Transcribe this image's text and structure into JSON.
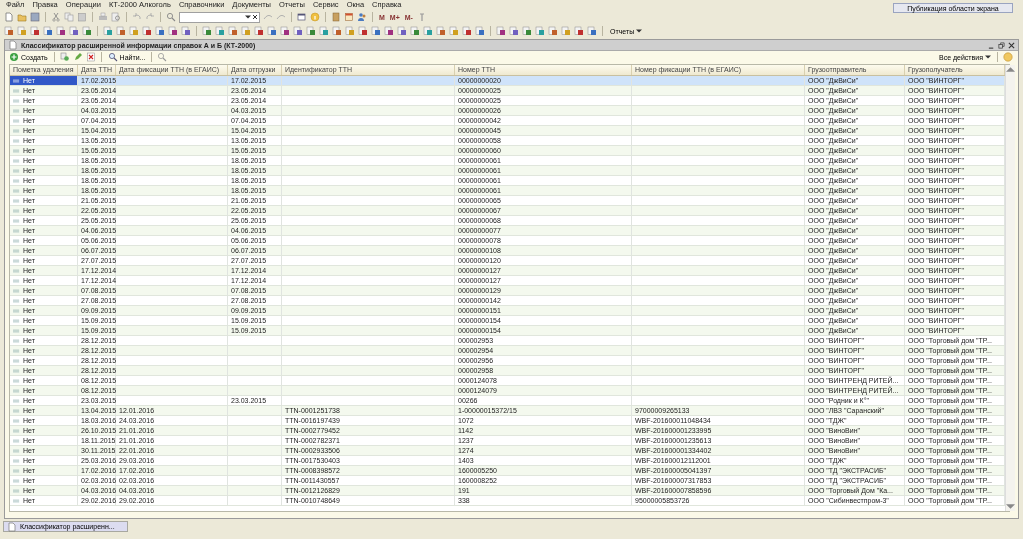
{
  "menu": [
    "Файл",
    "Правка",
    "Операции",
    "КТ-2000 Алкоголь",
    "Справочники",
    "Документы",
    "Отчеты",
    "Сервис",
    "Окна",
    "Справка"
  ],
  "memory_buttons": [
    "M",
    "M+",
    "M-"
  ],
  "reports_menu": "Отчеты",
  "publish_button": "Публикация области экрана",
  "window": {
    "title": "Классификатор расширенной информации справок А и Б (КТ-2000)"
  },
  "form_toolbar": {
    "create": "Создать",
    "find": "Найти...",
    "all_actions": "Все действия"
  },
  "table": {
    "columns": [
      "Пометка удаления",
      "Дата ТТН",
      "Дата фиксации ТТН (в ЕГАИС)",
      "Дата отгрузки",
      "Идентификатор ТТН",
      "Номер ТТН",
      "Номер фиксации ТТН (в ЕГАИС)",
      "Грузоотправитель",
      "Грузополучатель"
    ],
    "rows": [
      {
        "selected": true,
        "mark": "Нет",
        "date": "17.02.2015",
        "ship_date": "17.02.2015",
        "number": "00000000020",
        "sender": "ООО \"ДжВиСи\"",
        "receiver": "ООО \"ВИНТОРГ\""
      },
      {
        "selected": false,
        "mark": "Нет",
        "date": "23.05.2014",
        "ship_date": "23.05.2014",
        "number": "00000000025",
        "sender": "ООО \"ДжВиСи\"",
        "receiver": "ООО \"ВИНТОРГ\""
      },
      {
        "selected": false,
        "mark": "Нет",
        "date": "23.05.2014",
        "ship_date": "23.05.2014",
        "number": "00000000025",
        "sender": "ООО \"ДжВиСи\"",
        "receiver": "ООО \"ВИНТОРГ\""
      },
      {
        "selected": false,
        "mark": "Нет",
        "date": "04.03.2015",
        "ship_date": "04.03.2015",
        "number": "00000000026",
        "sender": "ООО \"ДжВиСи\"",
        "receiver": "ООО \"ВИНТОРГ\""
      },
      {
        "selected": false,
        "mark": "Нет",
        "date": "07.04.2015",
        "ship_date": "07.04.2015",
        "number": "00000000042",
        "sender": "ООО \"ДжВиСи\"",
        "receiver": "ООО \"ВИНТОРГ\""
      },
      {
        "selected": false,
        "mark": "Нет",
        "date": "15.04.2015",
        "ship_date": "15.04.2015",
        "number": "00000000045",
        "sender": "ООО \"ДжВиСи\"",
        "receiver": "ООО \"ВИНТОРГ\""
      },
      {
        "selected": false,
        "mark": "Нет",
        "date": "13.05.2015",
        "ship_date": "13.05.2015",
        "number": "00000000058",
        "sender": "ООО \"ДжВиСи\"",
        "receiver": "ООО \"ВИНТОРГ\""
      },
      {
        "selected": false,
        "mark": "Нет",
        "date": "15.05.2015",
        "ship_date": "15.05.2015",
        "number": "00000000060",
        "sender": "ООО \"ДжВиСи\"",
        "receiver": "ООО \"ВИНТОРГ\""
      },
      {
        "selected": false,
        "mark": "Нет",
        "date": "18.05.2015",
        "ship_date": "18.05.2015",
        "number": "00000000061",
        "sender": "ООО \"ДжВиСи\"",
        "receiver": "ООО \"ВИНТОРГ\""
      },
      {
        "selected": false,
        "mark": "Нет",
        "date": "18.05.2015",
        "ship_date": "18.05.2015",
        "number": "00000000061",
        "sender": "ООО \"ДжВиСи\"",
        "receiver": "ООО \"ВИНТОРГ\""
      },
      {
        "selected": false,
        "mark": "Нет",
        "date": "18.05.2015",
        "ship_date": "18.05.2015",
        "number": "00000000061",
        "sender": "ООО \"ДжВиСи\"",
        "receiver": "ООО \"ВИНТОРГ\""
      },
      {
        "selected": false,
        "mark": "Нет",
        "date": "18.05.2015",
        "ship_date": "18.05.2015",
        "number": "00000000061",
        "sender": "ООО \"ДжВиСи\"",
        "receiver": "ООО \"ВИНТОРГ\""
      },
      {
        "selected": false,
        "mark": "Нет",
        "date": "21.05.2015",
        "ship_date": "21.05.2015",
        "number": "00000000065",
        "sender": "ООО \"ДжВиСи\"",
        "receiver": "ООО \"ВИНТОРГ\""
      },
      {
        "selected": false,
        "mark": "Нет",
        "date": "22.05.2015",
        "ship_date": "22.05.2015",
        "number": "00000000067",
        "sender": "ООО \"ДжВиСи\"",
        "receiver": "ООО \"ВИНТОРГ\""
      },
      {
        "selected": false,
        "mark": "Нет",
        "date": "25.05.2015",
        "ship_date": "25.05.2015",
        "number": "00000000068",
        "sender": "ООО \"ДжВиСи\"",
        "receiver": "ООО \"ВИНТОРГ\""
      },
      {
        "selected": false,
        "mark": "Нет",
        "date": "04.06.2015",
        "ship_date": "04.06.2015",
        "number": "00000000077",
        "sender": "ООО \"ДжВиСи\"",
        "receiver": "ООО \"ВИНТОРГ\""
      },
      {
        "selected": false,
        "mark": "Нет",
        "date": "05.06.2015",
        "ship_date": "05.06.2015",
        "number": "00000000078",
        "sender": "ООО \"ДжВиСи\"",
        "receiver": "ООО \"ВИНТОРГ\""
      },
      {
        "selected": false,
        "mark": "Нет",
        "date": "06.07.2015",
        "ship_date": "06.07.2015",
        "number": "00000000108",
        "sender": "ООО \"ДжВиСи\"",
        "receiver": "ООО \"ВИНТОРГ\""
      },
      {
        "selected": false,
        "mark": "Нет",
        "date": "27.07.2015",
        "ship_date": "27.07.2015",
        "number": "00000000120",
        "sender": "ООО \"ДжВиСи\"",
        "receiver": "ООО \"ВИНТОРГ\""
      },
      {
        "selected": false,
        "mark": "Нет",
        "date": "17.12.2014",
        "ship_date": "17.12.2014",
        "number": "00000000127",
        "sender": "ООО \"ДжВиСи\"",
        "receiver": "ООО \"ВИНТОРГ\""
      },
      {
        "selected": false,
        "mark": "Нет",
        "date": "17.12.2014",
        "ship_date": "17.12.2014",
        "number": "00000000127",
        "sender": "ООО \"ДжВиСи\"",
        "receiver": "ООО \"ВИНТОРГ\""
      },
      {
        "selected": false,
        "mark": "Нет",
        "date": "07.08.2015",
        "ship_date": "07.08.2015",
        "number": "00000000129",
        "sender": "ООО \"ДжВиСи\"",
        "receiver": "ООО \"ВИНТОРГ\""
      },
      {
        "selected": false,
        "mark": "Нет",
        "date": "27.08.2015",
        "ship_date": "27.08.2015",
        "number": "00000000142",
        "sender": "ООО \"ДжВиСи\"",
        "receiver": "ООО \"ВИНТОРГ\""
      },
      {
        "selected": false,
        "mark": "Нет",
        "date": "09.09.2015",
        "ship_date": "09.09.2015",
        "number": "00000000151",
        "sender": "ООО \"ДжВиСи\"",
        "receiver": "ООО \"ВИНТОРГ\""
      },
      {
        "selected": false,
        "mark": "Нет",
        "date": "15.09.2015",
        "ship_date": "15.09.2015",
        "number": "00000000154",
        "sender": "ООО \"ДжВиСи\"",
        "receiver": "ООО \"ВИНТОРГ\""
      },
      {
        "selected": false,
        "mark": "Нет",
        "date": "15.09.2015",
        "ship_date": "15.09.2015",
        "number": "00000000154",
        "sender": "ООО \"ДжВиСи\"",
        "receiver": "ООО \"ВИНТОРГ\""
      },
      {
        "selected": false,
        "mark": "Нет",
        "date": "28.12.2015",
        "number": "000002953",
        "sender": "ООО \"ВИНТОРГ\"",
        "receiver": "ООО \"Торговый дом \"ТР..."
      },
      {
        "selected": false,
        "mark": "Нет",
        "date": "28.12.2015",
        "number": "000002954",
        "sender": "ООО \"ВИНТОРГ\"",
        "receiver": "ООО \"Торговый дом \"ТР..."
      },
      {
        "selected": false,
        "mark": "Нет",
        "date": "28.12.2015",
        "number": "000002956",
        "sender": "ООО \"ВИНТОРГ\"",
        "receiver": "ООО \"Торговый дом \"ТР..."
      },
      {
        "selected": false,
        "mark": "Нет",
        "date": "28.12.2015",
        "number": "000002958",
        "sender": "ООО \"ВИНТОРГ\"",
        "receiver": "ООО \"Торговый дом \"ТР..."
      },
      {
        "selected": false,
        "mark": "Нет",
        "date": "08.12.2015",
        "number": "0000124078",
        "sender": "ООО \"ВИНТРЕНД РИТЕЙ...",
        "receiver": "ООО \"Торговый дом \"ТР..."
      },
      {
        "selected": false,
        "mark": "Нет",
        "date": "08.12.2015",
        "number": "0000124079",
        "sender": "ООО \"ВИНТРЕНД РИТЕЙ...",
        "receiver": "ООО \"Торговый дом \"ТР..."
      },
      {
        "selected": false,
        "mark": "Нет",
        "date": "23.03.2015",
        "ship_date": "23.03.2015",
        "number": "00266",
        "sender": "ООО \"Родник и К°\"",
        "receiver": "ООО \"Торговый дом \"ТР..."
      },
      {
        "selected": false,
        "mark": "Нет",
        "date": "13.04.2015",
        "fix_date": "12.01.2016",
        "ttn_id": "TTN-0001251738",
        "number": "1-00000015372/15",
        "fix_number": "97000009265133",
        "sender": "ООО \"ЛВЗ \"Саранский\"",
        "receiver": "ООО \"Торговый дом \"ТР..."
      },
      {
        "selected": false,
        "mark": "Нет",
        "date": "18.03.2016",
        "fix_date": "24.03.2016",
        "ttn_id": "TTN-0016197439",
        "number": "1072",
        "fix_number": "WBF-201600011048434",
        "sender": "ООО \"ТДЖ\"",
        "receiver": "ООО \"Торговый дом \"ТР..."
      },
      {
        "selected": false,
        "mark": "Нет",
        "date": "26.10.2015",
        "fix_date": "21.01.2016",
        "ttn_id": "TTN-0002779452",
        "number": "1142",
        "fix_number": "WBF-201600001233995",
        "sender": "ООО \"ВиноВин\"",
        "receiver": "ООО \"Торговый дом \"ТР..."
      },
      {
        "selected": false,
        "mark": "Нет",
        "date": "18.11.2015",
        "fix_date": "21.01.2016",
        "ttn_id": "TTN-0002782371",
        "number": "1237",
        "fix_number": "WBF-201600001235613",
        "sender": "ООО \"ВиноВин\"",
        "receiver": "ООО \"Торговый дом \"ТР..."
      },
      {
        "selected": false,
        "mark": "Нет",
        "date": "30.11.2015",
        "fix_date": "22.01.2016",
        "ttn_id": "TTN-0002933506",
        "number": "1274",
        "fix_number": "WBF-201600001334402",
        "sender": "ООО \"ВиноВин\"",
        "receiver": "ООО \"Торговый дом \"ТР..."
      },
      {
        "selected": false,
        "mark": "Нет",
        "date": "25.03.2016",
        "fix_date": "29.03.2016",
        "ttn_id": "TTN-0017530403",
        "number": "1403",
        "fix_number": "WBF-201600012112001",
        "sender": "ООО \"ТДЖ\"",
        "receiver": "ООО \"Торговый дом \"ТР..."
      },
      {
        "selected": false,
        "mark": "Нет",
        "date": "17.02.2016",
        "fix_date": "17.02.2016",
        "ttn_id": "TTN-0008398572",
        "number": "1600005250",
        "fix_number": "WBF-201600005041397",
        "sender": "ООО \"ТД \"ЭКСТРАСИБ\"",
        "receiver": "ООО \"Торговый дом \"ТР..."
      },
      {
        "selected": false,
        "mark": "Нет",
        "date": "02.03.2016",
        "fix_date": "02.03.2016",
        "ttn_id": "TTN-0011430557",
        "number": "1600008252",
        "fix_number": "WBF-201600007317853",
        "sender": "ООО \"ТД \"ЭКСТРАСИБ\"",
        "receiver": "ООО \"Торговый дом \"ТР..."
      },
      {
        "selected": false,
        "mark": "Нет",
        "date": "04.03.2016",
        "fix_date": "04.03.2016",
        "ttn_id": "TTN-0012126829",
        "number": "191",
        "fix_number": "WBF-201600007858596",
        "sender": "ООО \"Торговый Дом \"Ка...",
        "receiver": "ООО \"Торговый дом \"ТР..."
      },
      {
        "selected": false,
        "mark": "Нет",
        "date": "29.02.2016",
        "fix_date": "29.02.2016",
        "ttn_id": "TTN-0010748649",
        "number": "338",
        "fix_number": "95000005853726",
        "sender": "ООО \"Сибинвестпром-3\"",
        "receiver": "ООО \"Торговый дом \"ТР..."
      }
    ]
  },
  "taskbar": [
    {
      "label": "Классификатор расширенн...",
      "selected": true
    }
  ]
}
